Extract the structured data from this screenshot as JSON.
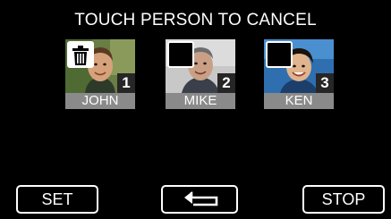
{
  "header": {
    "title": "TOUCH PERSON TO CANCEL"
  },
  "people": [
    {
      "name": "JOHN",
      "number": "1",
      "selected": true
    },
    {
      "name": "MIKE",
      "number": "2",
      "selected": false
    },
    {
      "name": "KEN",
      "number": "3",
      "selected": false
    }
  ],
  "buttons": {
    "set": "SET",
    "back_icon": "return-arrow-icon",
    "stop": "STOP"
  },
  "colors": {
    "background": "#000000",
    "name_label_bg": "#8a8a8a",
    "text": "#ffffff"
  }
}
